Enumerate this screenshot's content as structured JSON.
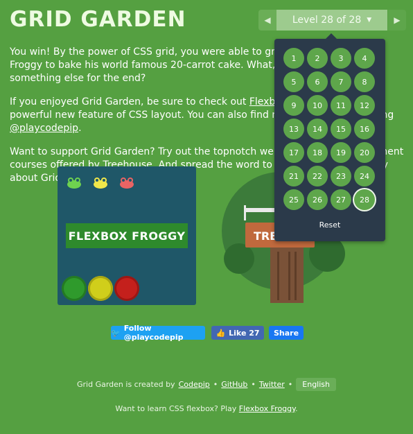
{
  "header": {
    "title": "GRID GARDEN"
  },
  "level_nav": {
    "prev_icon": "chevron-left",
    "label": "Level 28 of 28",
    "dropdown_icon": "caret-down",
    "next_icon": "chevron-right"
  },
  "message": {
    "p1": "You win! By the power of CSS grid, you were able to grow enough carrots for Froggy to bake his world famous 20-carrot cake. What, were you expecting something else for the end?",
    "p2_pre": "If you enjoyed Grid Garden, be sure to check out ",
    "p2_link1": "Flexbox Froggy",
    "p2_mid": " for another powerful new feature of CSS layout. You can also find new content by following ",
    "p2_link2": "@playcodepip",
    "p2_post": ".",
    "p3_pre": "Want to support Grid Garden? Try out the topnotch web design and development courses offered by ",
    "p3_link": "Treehouse",
    "p3_post": ". And spread the word to your friends and family about Grid Garden!"
  },
  "promo": {
    "froggy_banner": "FLEXBOX FROGGY",
    "treehouse_banner": "TREEHOUSE"
  },
  "social": {
    "twitter_label": "Follow @playcodepip",
    "like_label": "Like 27",
    "share_label": "Share"
  },
  "footer": {
    "created_by": "Grid Garden is created by",
    "codepip": "Codepip",
    "sep": "•",
    "github": "GitHub",
    "twitter": "Twitter",
    "language": "English",
    "flexbox_pre": "Want to learn CSS flexbox? Play ",
    "flexbox_link": "Flexbox Froggy",
    "flexbox_post": "."
  },
  "levels": {
    "items": [
      "1",
      "2",
      "3",
      "4",
      "5",
      "6",
      "7",
      "8",
      "9",
      "10",
      "11",
      "12",
      "13",
      "14",
      "15",
      "16",
      "17",
      "18",
      "19",
      "20",
      "21",
      "22",
      "23",
      "24",
      "25",
      "26",
      "27",
      "28"
    ],
    "current": "28",
    "reset_label": "Reset"
  },
  "colors": {
    "background": "#55a041",
    "dropdown": "#2b3a4a",
    "level_bubble": "#5ea64b"
  }
}
